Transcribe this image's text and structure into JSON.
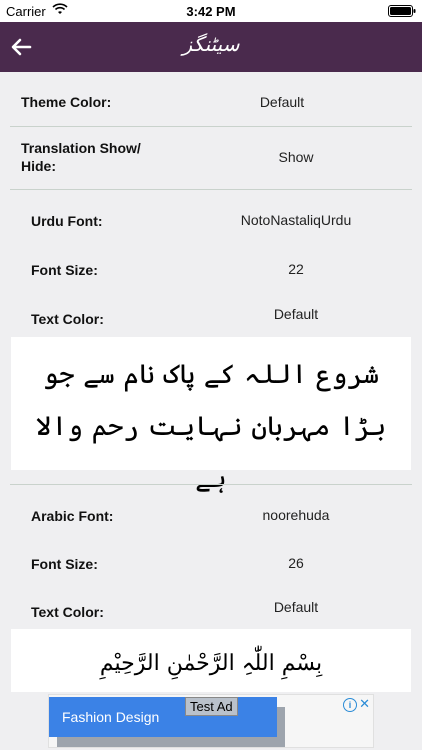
{
  "status_bar": {
    "carrier": "Carrier",
    "time": "3:42 PM"
  },
  "nav": {
    "title": "سیٹنگز"
  },
  "settings": {
    "theme_color": {
      "label": "Theme Color:",
      "value": "Default"
    },
    "translation": {
      "label": "Translation Show/\nHide:",
      "value": "Show"
    }
  },
  "urdu": {
    "font": {
      "label": "Urdu Font:",
      "value": "NotoNastaliqUrdu"
    },
    "size": {
      "label": "Font Size:",
      "value": "22"
    },
    "color": {
      "label": "Text Color:",
      "value": "Default"
    },
    "preview_text": "شروع اللہ کے پاک نام سے جو بڑا مہربان نہایت رحم والا ہے"
  },
  "arabic": {
    "font": {
      "label": "Arabic Font:",
      "value": "noorehuda"
    },
    "size": {
      "label": "Font Size:",
      "value": "26"
    },
    "color": {
      "label": "Text Color:",
      "value": "Default"
    },
    "preview_text": "بِسْمِ اللّٰہِ الرَّحْمٰنِ الرَّحِیْمِ"
  },
  "ad": {
    "button_text": "Fashion Design",
    "label": "Test Ad"
  },
  "colors": {
    "nav_bg": "#4a2a4d",
    "background": "#efeff1",
    "ad_button": "#3b82e6"
  }
}
